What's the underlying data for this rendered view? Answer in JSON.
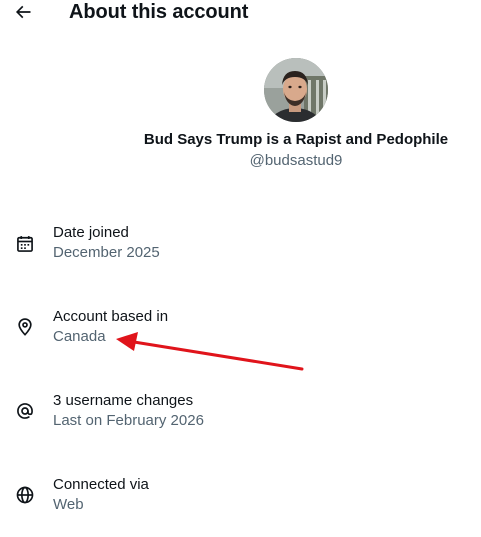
{
  "header": {
    "title": "About this account",
    "back_icon": "arrow-left-icon"
  },
  "profile": {
    "display_name": "Bud Says Trump is a Rapist and Pedophile",
    "handle": "@budsastud9"
  },
  "rows": [
    {
      "icon": "calendar-icon",
      "label": "Date joined",
      "value": "December 2025"
    },
    {
      "icon": "location-pin-icon",
      "label": "Account based in",
      "value": "Canada"
    },
    {
      "icon": "at-sign-icon",
      "label": "3 username changes",
      "value": "Last on February 2026"
    },
    {
      "icon": "globe-icon",
      "label": "Connected via",
      "value": "Web"
    }
  ],
  "colors": {
    "primary_text": "#0f1419",
    "secondary_text": "#536471",
    "annotation_arrow": "#e0141b"
  }
}
